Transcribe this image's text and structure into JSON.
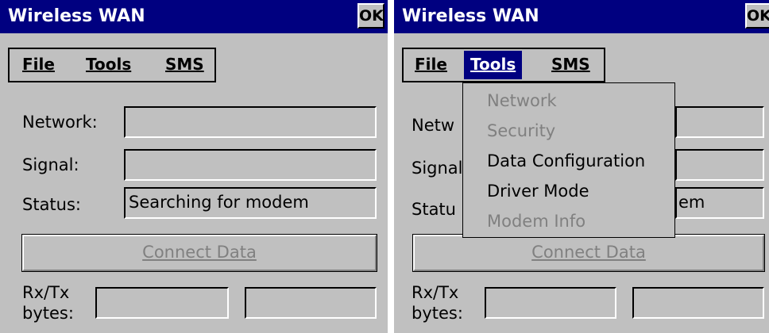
{
  "window_title": "Wireless WAN",
  "ok_label": "OK",
  "menu": {
    "file": "File",
    "tools": "Tools",
    "sms": "SMS"
  },
  "labels": {
    "network": "Network:",
    "signal": "Signal:",
    "status": "Status:",
    "rxtx_line1": "Rx/Tx",
    "rxtx_line2": "bytes:"
  },
  "right_labels_clipped": {
    "network": "Netw",
    "signal": "Signal",
    "status": "Statu"
  },
  "fields": {
    "network": "",
    "signal": "",
    "status": "Searching for modem",
    "status_visible_tail": "em",
    "rx": "",
    "tx": ""
  },
  "connect_button": "Connect Data",
  "tools_menu": [
    {
      "label": "Network",
      "enabled": false
    },
    {
      "label": "Security",
      "enabled": false
    },
    {
      "label": "Data Configuration",
      "enabled": true
    },
    {
      "label": "Driver Mode",
      "enabled": true
    },
    {
      "label": "Modem Info",
      "enabled": false
    }
  ],
  "colors": {
    "face": "#c0c0c0",
    "title_bar": "#000080",
    "disabled_text": "#808080"
  }
}
